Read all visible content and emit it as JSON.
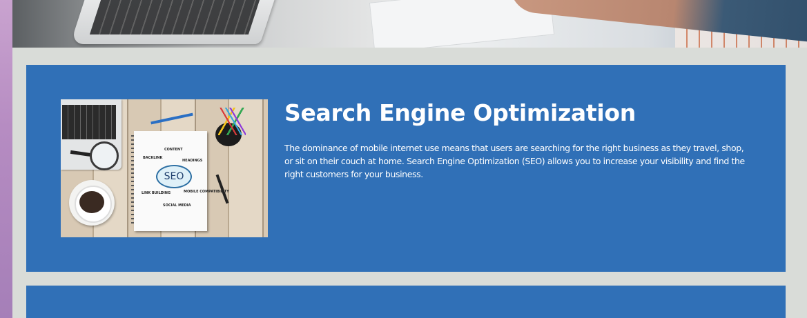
{
  "seo_section": {
    "title": "Search Engine Optimization",
    "description": "The dominance of mobile internet use means that users are searching for the right business as they travel, shop, or sit on their couch at home. Search Engine Optimization (SEO) allows you to increase your visibility and find the right customers for your business.",
    "image_words": {
      "center": "SEO",
      "content": "CONTENT",
      "backlink": "BACKLINK",
      "headings": "HEADINGS",
      "link_building": "LINK BUILDING",
      "mobile": "MOBILE COMPATIBILITY",
      "social": "SOCIAL MEDIA"
    }
  },
  "colors": {
    "card_background": "#3070b7",
    "page_background": "#d9dcd8",
    "text": "#ffffff"
  }
}
